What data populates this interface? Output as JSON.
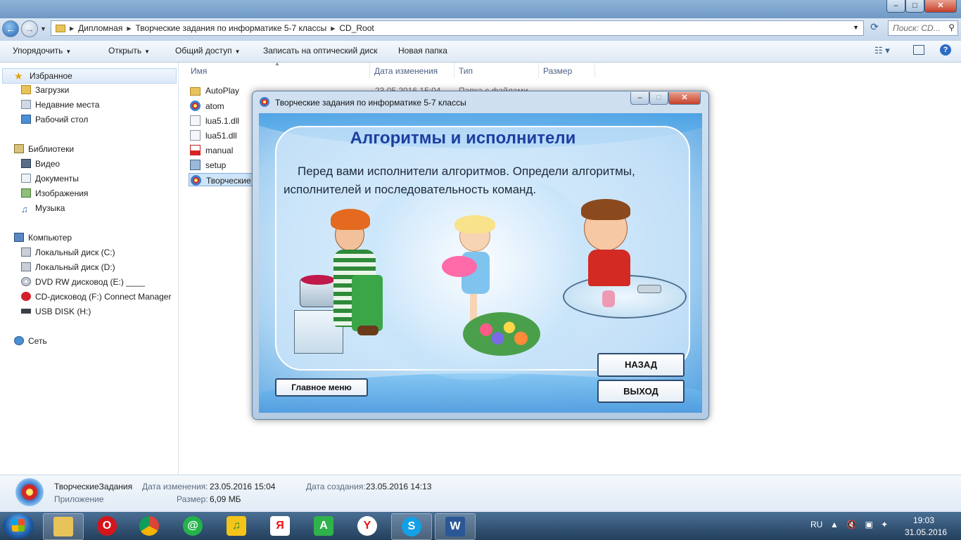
{
  "explorer": {
    "breadcrumb": [
      "Дипломная",
      "Творческие задания по информатике 5-7 классы",
      "CD_Root"
    ],
    "search_placeholder": "Поиск: CD...",
    "toolbar": {
      "organize": "Упорядочить",
      "open": "Открыть",
      "share": "Общий доступ",
      "burn": "Записать на оптический диск",
      "new_folder": "Новая папка"
    },
    "nav": {
      "favorites": "Избранное",
      "downloads": "Загрузки",
      "recent": "Недавние места",
      "desktop": "Рабочий стол",
      "libraries": "Библиотеки",
      "video": "Видео",
      "documents": "Документы",
      "images": "Изображения",
      "music": "Музыка",
      "computer": "Компьютер",
      "disk_c": "Локальный диск (C:)",
      "disk_d": "Локальный диск (D:)",
      "dvd": "DVD RW дисковод (E:) ____",
      "cd": "CD-дисковод (F:) Connect Manager",
      "usb": "USB DISK (H:)",
      "network": "Сеть"
    },
    "columns": {
      "name": "Имя",
      "date": "Дата изменения",
      "type": "Тип",
      "size": "Размер"
    },
    "files": [
      {
        "name": "AutoPlay",
        "date": "23.05.2016 15:04",
        "type": "Папка с файлами"
      },
      {
        "name": "atom"
      },
      {
        "name": "lua5.1.dll"
      },
      {
        "name": "lua51.dll"
      },
      {
        "name": "manual"
      },
      {
        "name": "setup"
      },
      {
        "name": "Творческие"
      }
    ],
    "details": {
      "name": "ТворческиеЗадания",
      "kind": "Приложение",
      "modified_label": "Дата изменения:",
      "modified_value": "23.05.2016 15:04",
      "size_label": "Размер:",
      "size_value": "6,09 МБ",
      "created_label": "Дата создания:",
      "created_value": "23.05.2016 14:13"
    }
  },
  "app": {
    "window_title": "Творческие задания по информатике 5-7 классы",
    "heading": "Алгоритмы и исполнители",
    "text": "Перед вами исполнители алгоритмов. Определи алгоритмы, исполнителей и последовательность команд.",
    "buttons": {
      "main_menu": "Главное меню",
      "back": "НАЗАД",
      "exit": "ВЫХОД"
    }
  },
  "taskbar": {
    "lang": "RU",
    "time": "19:03",
    "date": "31.05.2016",
    "apps": [
      "explorer",
      "opera",
      "chrome",
      "mail",
      "music",
      "yandex",
      "android",
      "yandex-browser",
      "skype",
      "word"
    ]
  },
  "colors": {
    "heading": "#1c3fa0",
    "taskbar": "#233f5c",
    "accent": "#2a6cc4"
  }
}
